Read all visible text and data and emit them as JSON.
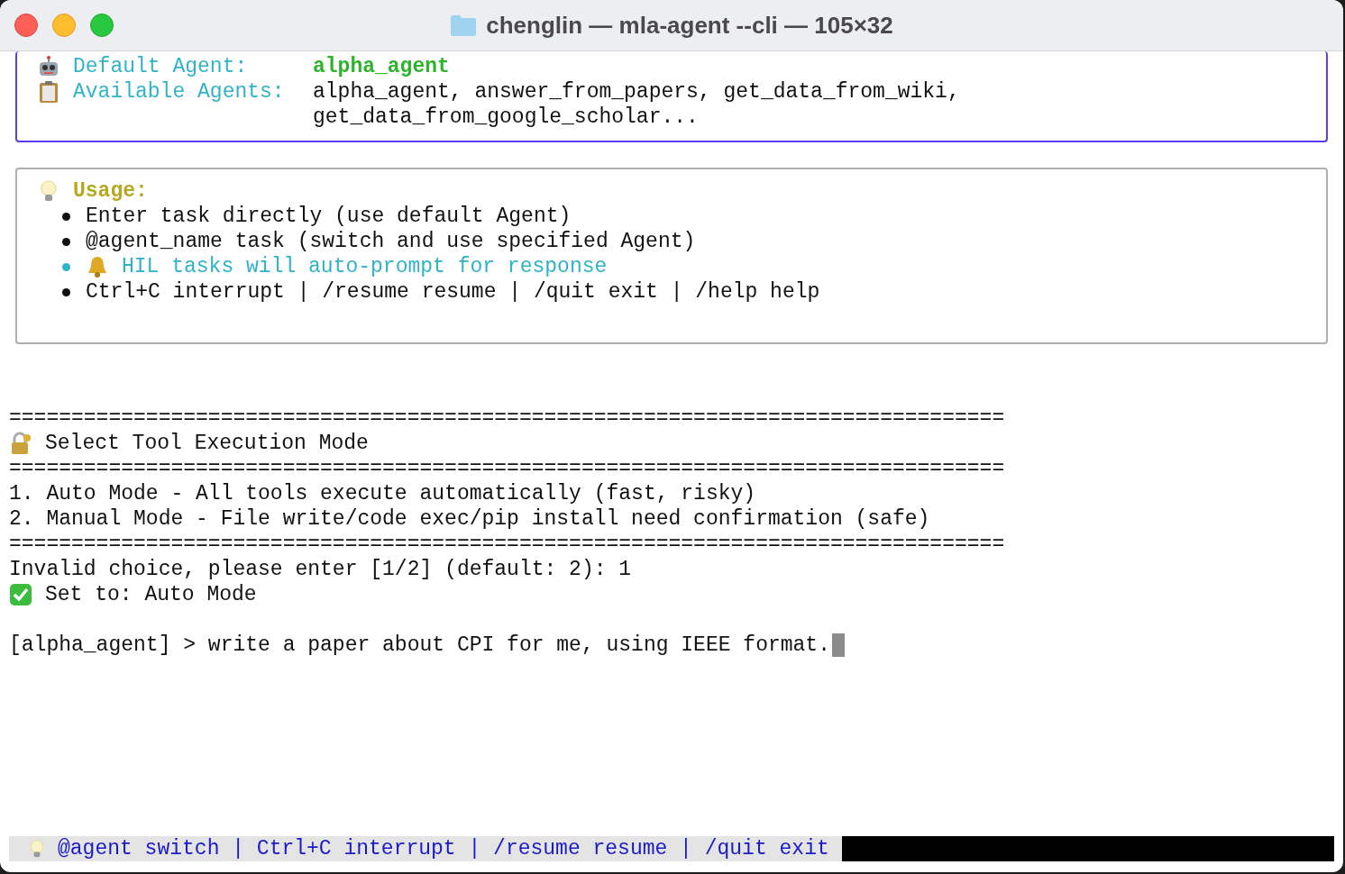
{
  "window": {
    "title": "chenglin — mla-agent --cli — 105×32"
  },
  "agent_info": [
    {
      "kind": "default",
      "label": "Default Agent:",
      "value_lines": [
        "alpha_agent"
      ]
    },
    {
      "kind": "list",
      "label": "Available Agents:",
      "value_lines": [
        "alpha_agent, answer_from_papers, get_data_from_wiki,",
        "get_data_from_google_scholar..."
      ]
    }
  ],
  "usage": {
    "title": "Usage:",
    "items": [
      {
        "kind": "plain",
        "text": "Enter task directly (use default Agent)"
      },
      {
        "kind": "plain",
        "text": "@agent_name task (switch and use specified Agent)"
      },
      {
        "kind": "highlight",
        "text": "HIL tasks will auto-prompt for response"
      },
      {
        "kind": "plain",
        "text": "Ctrl+C interrupt | /resume resume | /quit exit | /help help"
      }
    ]
  },
  "console": [
    {
      "kind": "rule",
      "text": "================================================================================"
    },
    {
      "kind": "heading",
      "text": "Select Tool Execution Mode"
    },
    {
      "kind": "rule",
      "text": "================================================================================"
    },
    {
      "kind": "line",
      "text": "1. Auto Mode - All tools execute automatically (fast, risky)"
    },
    {
      "kind": "line",
      "text": "2. Manual Mode - File write/code exec/pip install need confirmation (safe)"
    },
    {
      "kind": "rule",
      "text": "================================================================================"
    },
    {
      "kind": "line",
      "text": "Invalid choice, please enter [1/2] (default: 2): 1"
    },
    {
      "kind": "success",
      "text": "Set to: Auto Mode"
    },
    {
      "kind": "blank"
    },
    {
      "kind": "prompt",
      "text": "[alpha_agent] > write a paper about CPI for me, using IEEE format."
    }
  ],
  "status_bar": {
    "text": "@agent switch | Ctrl+C interrupt | /resume resume | /quit exit"
  }
}
